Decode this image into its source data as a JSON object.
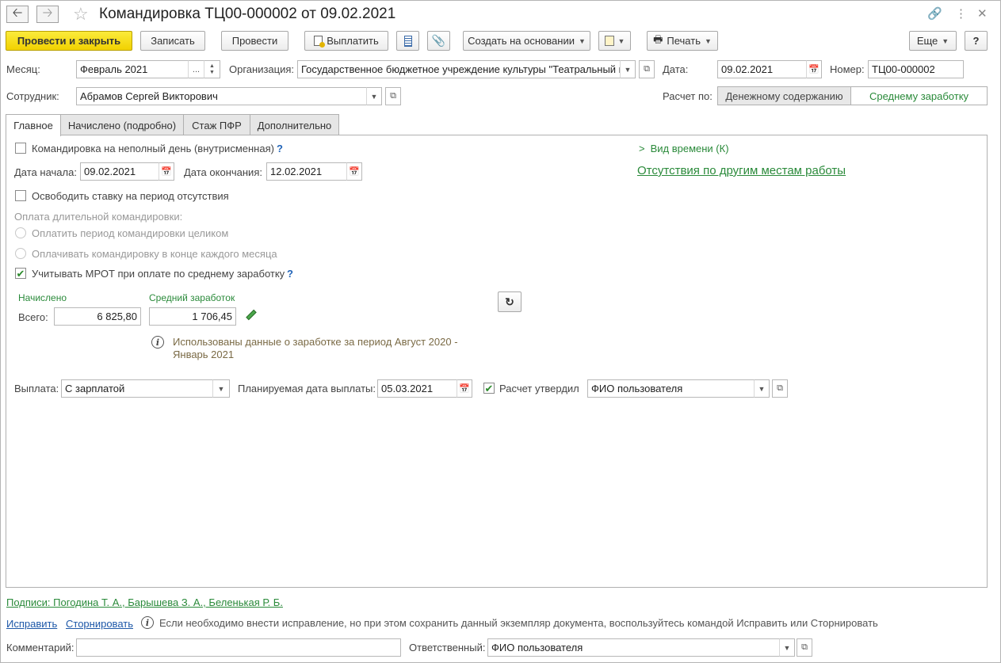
{
  "window": {
    "title": "Командировка ТЦ00-000002 от 09.02.2021"
  },
  "toolbar": {
    "post_close": "Провести и закрыть",
    "write": "Записать",
    "post": "Провести",
    "pay": "Выплатить",
    "create_based": "Создать на основании",
    "print": "Печать",
    "more": "Еще",
    "help": "?"
  },
  "header": {
    "month_label": "Месяц:",
    "month_value": "Февраль 2021",
    "org_label": "Организация:",
    "org_value": "Государственное бюджетное учреждение культуры \"Театральный ц",
    "date_label": "Дата:",
    "date_value": "09.02.2021",
    "number_label": "Номер:",
    "number_value": "ТЦ00-000002",
    "employee_label": "Сотрудник:",
    "employee_value": "Абрамов Сергей Викторович",
    "calc_label": "Расчет по:",
    "calc_opt1": "Денежному содержанию",
    "calc_opt2": "Среднему заработку"
  },
  "tabs": [
    {
      "label": "Главное"
    },
    {
      "label": "Начислено (подробно)"
    },
    {
      "label": "Стаж ПФР"
    },
    {
      "label": "Дополнительно"
    }
  ],
  "main": {
    "partial_day_label": "Командировка на неполный день (внутрисменная)",
    "help_mark": "?",
    "start_label": "Дата начала:",
    "start_value": "09.02.2021",
    "end_label": "Дата окончания:",
    "end_value": "12.02.2021",
    "free_rate_label": "Освободить ставку на период отсутствия",
    "long_trip_label": "Оплата длительной командировки:",
    "pay_whole_label": "Оплатить период командировки целиком",
    "pay_monthly_label": "Оплачивать командировку в конце каждого месяца",
    "mrot_label": "Учитывать МРОТ при оплате по среднему заработку",
    "time_type_label": "Вид времени (К)",
    "absence_link": "Отсутствия по другим местам работы",
    "accrued_label": "Начислено",
    "avg_label": "Средний заработок",
    "total_label": "Всего:",
    "total_value": "6 825,80",
    "avg_value": "1 706,45",
    "info_text_1": "Использованы данные о заработке за период Август 2020 -",
    "info_text_2": "Январь 2021",
    "payout_label": "Выплата:",
    "payout_value": "С зарплатой",
    "plan_date_label": "Планируемая дата выплаты:",
    "plan_date_value": "05.03.2021",
    "approved_label": "Расчет утвердил",
    "approved_value": "ФИО пользователя"
  },
  "footer": {
    "signatures": "Подписи: Погодина Т. А., Барышева З. А., Беленькая Р. Б.",
    "fix": "Исправить",
    "storno": "Сторнировать",
    "note": "Если необходимо внести исправление, но при этом сохранить данный экземпляр документа, воспользуйтесь командой Исправить или Сторнировать",
    "comment_label": "Комментарий:",
    "comment_value": "",
    "responsible_label": "Ответственный:",
    "responsible_value": "ФИО пользователя"
  },
  "colors": {
    "primary_button": "#f1d100",
    "green_text": "#2a8a3a",
    "link_blue": "#1e58a8"
  }
}
